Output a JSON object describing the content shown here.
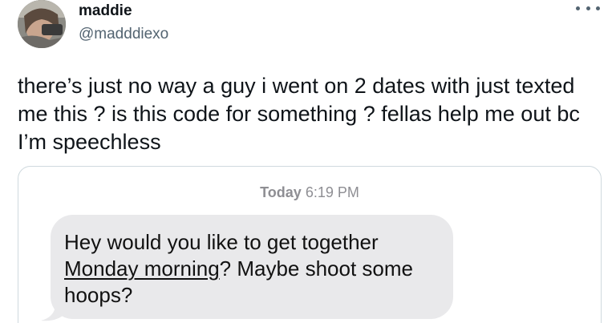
{
  "user": {
    "display_name": "maddie",
    "handle": "@madddiexo",
    "avatar_icon": "profile-photo",
    "more_icon": "more-horizontal-icon"
  },
  "tweet": {
    "text": "there’s just no way a guy i went on 2 dates with just texted me this ? is this code for something ? fellas help me out bc I’m speechless"
  },
  "screenshot": {
    "timestamp_day": "Today",
    "timestamp_time": "6:19 PM",
    "message_part1": "Hey would you like to get together ",
    "message_link": "Monday morning",
    "message_part2": "? Maybe shoot some hoops?",
    "bubble_color": "#e9e9eb"
  }
}
